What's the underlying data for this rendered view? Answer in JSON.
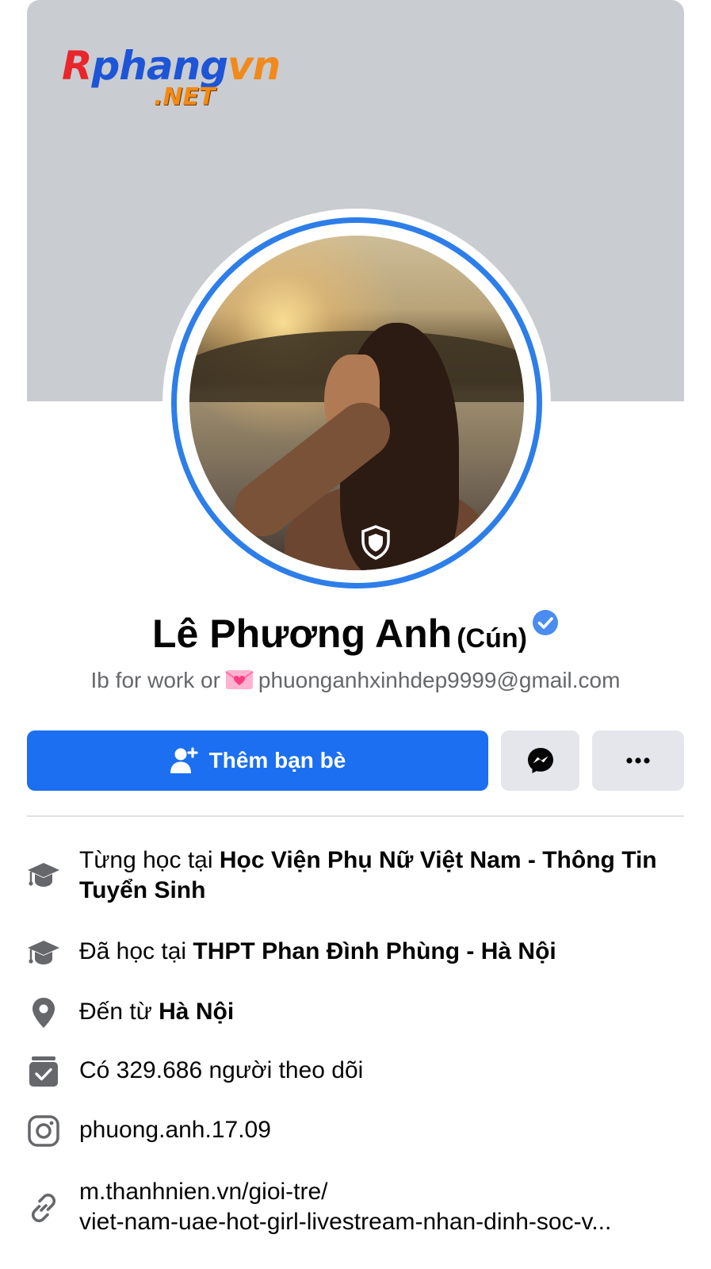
{
  "watermark": {
    "main": "Rphangvn",
    "sub": ".NET"
  },
  "profile": {
    "name": "Lê Phương Anh",
    "nickname": "(Cún)",
    "bio_prefix": "Ib for work or",
    "bio_email": "phuonganhxinhdep9999@gmail.com"
  },
  "actions": {
    "add_friend_label": "Thêm bạn bè"
  },
  "details": {
    "study1_prefix": "Từng học tại",
    "study1_place": "Học Viện Phụ Nữ Việt Nam - Thông Tin Tuyển Sinh",
    "study2_prefix": "Đã học tại",
    "study2_place": "THPT Phan Đình Phùng - Hà Nội",
    "from_prefix": "Đến từ",
    "from_place": "Hà Nội",
    "followers": "Có 329.686 người theo dõi",
    "instagram": "phuong.anh.17.09",
    "link_line1": "m.thanhnien.vn/gioi-tre/",
    "link_line2": "viet-nam-uae-hot-girl-livestream-nhan-dinh-soc-v..."
  },
  "colors": {
    "accent": "#1b6ff0",
    "verified": "#4a8cf0",
    "cover": "#c9ccd1"
  },
  "icons": [
    "user-plus-icon",
    "messenger-icon",
    "more-dots-icon",
    "graduation-cap-icon",
    "location-pin-icon",
    "followers-icon",
    "instagram-icon",
    "link-icon",
    "verified-badge-icon",
    "shield-icon",
    "heart-letter-icon"
  ]
}
